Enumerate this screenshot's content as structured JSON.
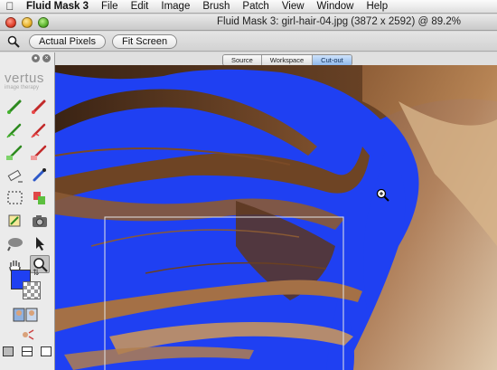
{
  "menubar": {
    "items": [
      "Fluid Mask 3",
      "File",
      "Edit",
      "Image",
      "Brush",
      "Patch",
      "View",
      "Window",
      "Help"
    ]
  },
  "window": {
    "title": "Fluid Mask 3: girl-hair-04.jpg (3872 x 2592) @ 89.2%"
  },
  "toolbar": {
    "actual_pixels": "Actual Pixels",
    "fit_screen": "Fit Screen"
  },
  "panel": {
    "logo": "vertus",
    "logo_sub": "image therapy",
    "tools": [
      "keep-brush",
      "delete-brush",
      "keep-local-brush",
      "delete-local-brush",
      "keep-exact-brush",
      "delete-exact-brush",
      "eraser",
      "fill-tool",
      "rectangle-select",
      "object-tool",
      "patch-tool",
      "camera",
      "blend-tool",
      "pointer",
      "hand",
      "zoom",
      "color-swap",
      "background-swatch",
      "people",
      "replace-tool"
    ],
    "foreground_color": "#1f40f2"
  },
  "tabs": [
    "Source",
    "Workspace",
    "Cut-out"
  ],
  "selected_tab": "Cut-out",
  "colors": {
    "cutout_blue": "#1f40f2",
    "tab_selected": "#8fb8ec"
  }
}
